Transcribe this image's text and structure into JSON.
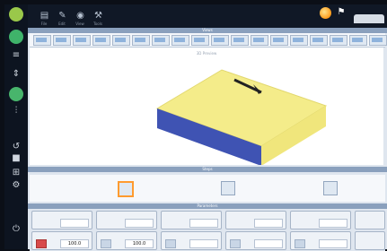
{
  "topbar": {
    "tools": [
      {
        "icon": "file-icon",
        "label": "File"
      },
      {
        "icon": "edit-icon",
        "label": "Edit"
      },
      {
        "icon": "view-icon",
        "label": "View"
      },
      {
        "icon": "tools-icon",
        "label": "Tools"
      }
    ]
  },
  "sections": {
    "views_header": "Views",
    "steps_header": "Steps",
    "params_header": "Parameters",
    "canvas_title": "3D Preview"
  },
  "params": {
    "row1": [
      "",
      "",
      "",
      "",
      ""
    ],
    "row2": [
      {
        "label": "",
        "value": "100.0"
      },
      {
        "label": "",
        "value": "100.0"
      },
      {
        "label": "",
        "value": ""
      },
      {
        "label": "",
        "value": ""
      },
      {
        "label": "",
        "value": ""
      }
    ]
  },
  "colors": {
    "box_top": "#f4ec8a",
    "box_side": "#3f53b3",
    "accent": "#ff9b2f"
  }
}
